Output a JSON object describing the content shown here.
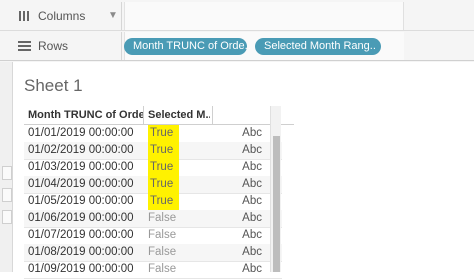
{
  "shelves": {
    "columns": {
      "label": "Columns",
      "icon": "columns-icon"
    },
    "rows": {
      "label": "Rows",
      "icon": "rows-icon",
      "pills": [
        "Month TRUNC of Orde..",
        "Selected Month Rang.."
      ]
    }
  },
  "sheet": {
    "title": "Sheet 1"
  },
  "table": {
    "headers": [
      "Month TRUNC of Orde..",
      "Selected M.."
    ],
    "rows": [
      {
        "date": "01/01/2019 00:00:00",
        "selected": "True",
        "value": "Abc"
      },
      {
        "date": "01/02/2019 00:00:00",
        "selected": "True",
        "value": "Abc"
      },
      {
        "date": "01/03/2019 00:00:00",
        "selected": "True",
        "value": "Abc"
      },
      {
        "date": "01/04/2019 00:00:00",
        "selected": "True",
        "value": "Abc"
      },
      {
        "date": "01/05/2019 00:00:00",
        "selected": "True",
        "value": "Abc"
      },
      {
        "date": "01/06/2019 00:00:00",
        "selected": "False",
        "value": "Abc"
      },
      {
        "date": "01/07/2019 00:00:00",
        "selected": "False",
        "value": "Abc"
      },
      {
        "date": "01/08/2019 00:00:00",
        "selected": "False",
        "value": "Abc"
      },
      {
        "date": "01/09/2019 00:00:00",
        "selected": "False",
        "value": "Abc"
      }
    ]
  },
  "colors": {
    "pill": "#4a9bb5",
    "highlight": "#fff200"
  }
}
